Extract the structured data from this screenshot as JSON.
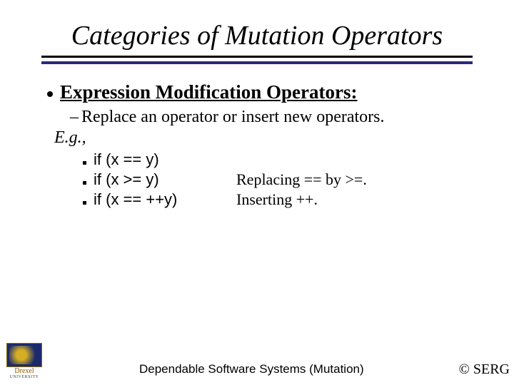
{
  "title": "Categories of Mutation Operators",
  "heading": "Expression Modification Operators:",
  "sub_desc": "Replace an operator or insert new operators.",
  "eg_label": "E.g.,",
  "examples": [
    {
      "code": "if (x == y)",
      "note": ""
    },
    {
      "code": "if (x >= y)",
      "note": "Replacing == by >=."
    },
    {
      "code": "if (x == ++y)",
      "note": "Inserting ++."
    }
  ],
  "logo": {
    "name": "Drexel",
    "sub": "UNIVERSITY"
  },
  "footer_center": "Dependable Software Systems (Mutation)",
  "footer_right": "© SERG"
}
